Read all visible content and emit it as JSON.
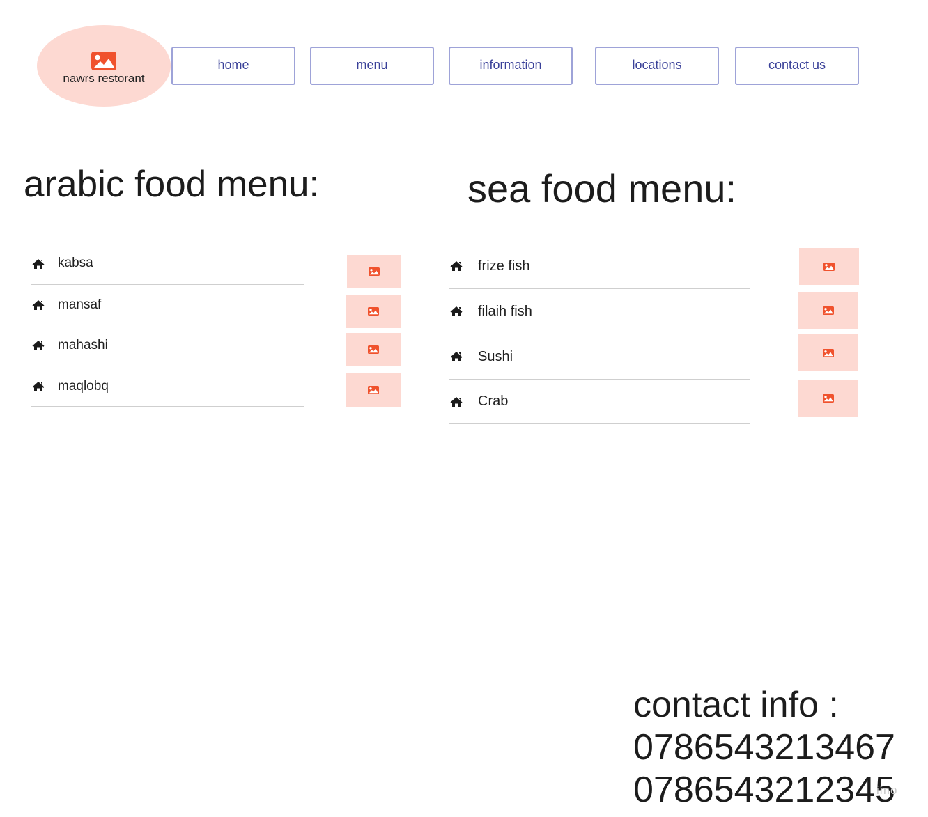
{
  "brand": {
    "logo_text": "nawrs restorant",
    "logo_icon": "image-icon"
  },
  "nav": {
    "items": [
      {
        "label": "home"
      },
      {
        "label": "menu"
      },
      {
        "label": "information"
      },
      {
        "label": "locations"
      },
      {
        "label": "contact us"
      }
    ]
  },
  "arabic_menu": {
    "title": "arabic food menu:",
    "items": [
      {
        "name": "kabsa",
        "icon": "home-icon"
      },
      {
        "name": "mansaf",
        "icon": "home-icon"
      },
      {
        "name": "mahashi",
        "icon": "home-icon"
      },
      {
        "name": "maqlobq",
        "icon": "home-icon"
      }
    ]
  },
  "sea_menu": {
    "title": "sea food menu:",
    "items": [
      {
        "name": "frize fish",
        "icon": "home-icon"
      },
      {
        "name": "filaih fish",
        "icon": "home-icon"
      },
      {
        "name": "Sushi",
        "icon": "home-icon"
      },
      {
        "name": "Crab",
        "icon": "home-icon"
      }
    ]
  },
  "contact": {
    "title": "contact info :",
    "phones": [
      "0786543213467",
      "0786543212345"
    ]
  },
  "watermark": "imo",
  "colors": {
    "accent": "#f0522d",
    "pink": "#fdd9d2",
    "nav_border": "#9ea3d8",
    "nav_text": "#3a4199"
  }
}
